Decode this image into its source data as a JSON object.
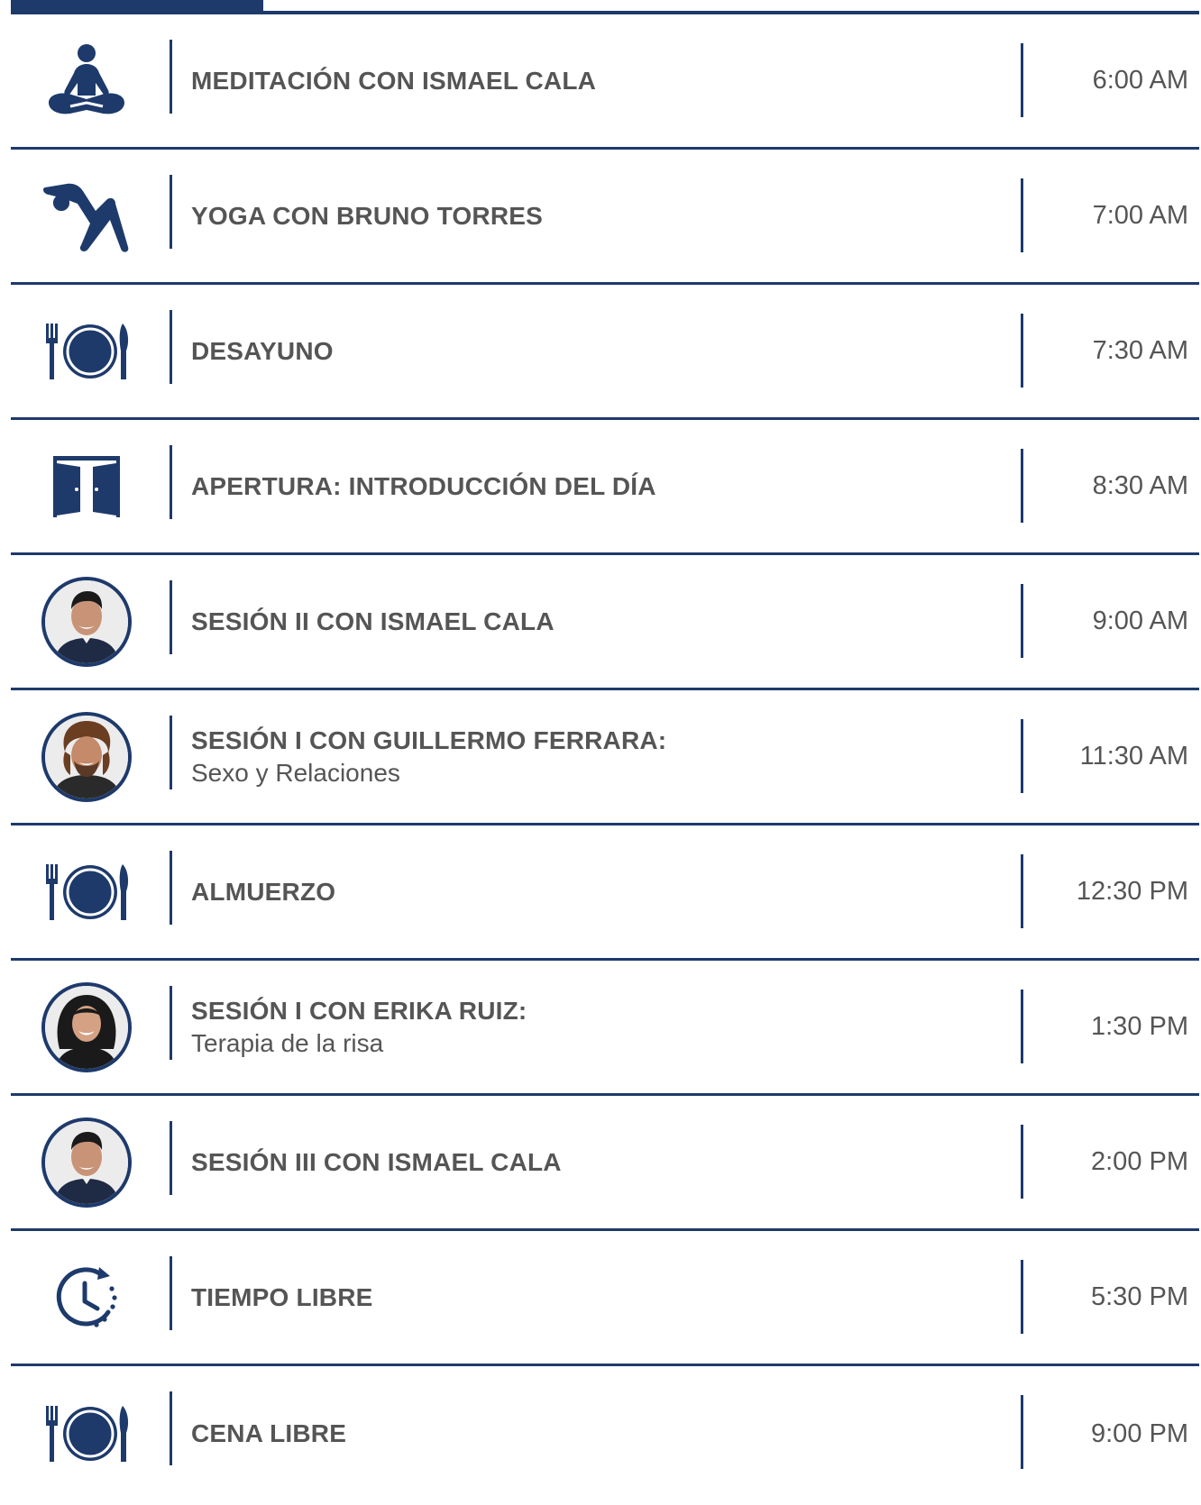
{
  "colors": {
    "accent": "#1e3a6b",
    "text": "#555555",
    "background": "#ffffff"
  },
  "rows": [
    {
      "icon": "meditation-icon",
      "title": "MEDITACIÓN CON ISMAEL CALA",
      "subtitle": "",
      "time": "6:00 AM"
    },
    {
      "icon": "yoga-icon",
      "title": "YOGA CON BRUNO TORRES",
      "subtitle": "",
      "time": "7:00 AM"
    },
    {
      "icon": "dining-icon",
      "title": "DESAYUNO",
      "subtitle": "",
      "time": "7:30 AM"
    },
    {
      "icon": "door-icon",
      "title": "APERTURA: INTRODUCCIÓN DEL DÍA",
      "subtitle": "",
      "time": "8:30 AM"
    },
    {
      "icon": "avatar-photo",
      "title": "SESIÓN II CON ISMAEL CALA",
      "subtitle": "",
      "time": "9:00 AM"
    },
    {
      "icon": "avatar-photo",
      "title": "SESIÓN I CON GUILLERMO FERRARA:",
      "subtitle": "Sexo y Relaciones",
      "time": "11:30 AM"
    },
    {
      "icon": "dining-icon",
      "title": "ALMUERZO",
      "subtitle": "",
      "time": "12:30 PM"
    },
    {
      "icon": "avatar-photo",
      "title": "SESIÓN I CON ERIKA RUIZ:",
      "subtitle": "Terapia de la risa",
      "time": "1:30 PM"
    },
    {
      "icon": "avatar-photo",
      "title": "SESIÓN III CON ISMAEL CALA",
      "subtitle": "",
      "time": "2:00 PM"
    },
    {
      "icon": "clock-icon",
      "title": "TIEMPO LIBRE",
      "subtitle": "",
      "time": "5:30 PM"
    },
    {
      "icon": "dining-icon",
      "title": "CENA LIBRE",
      "subtitle": "",
      "time": "9:00 PM"
    }
  ]
}
